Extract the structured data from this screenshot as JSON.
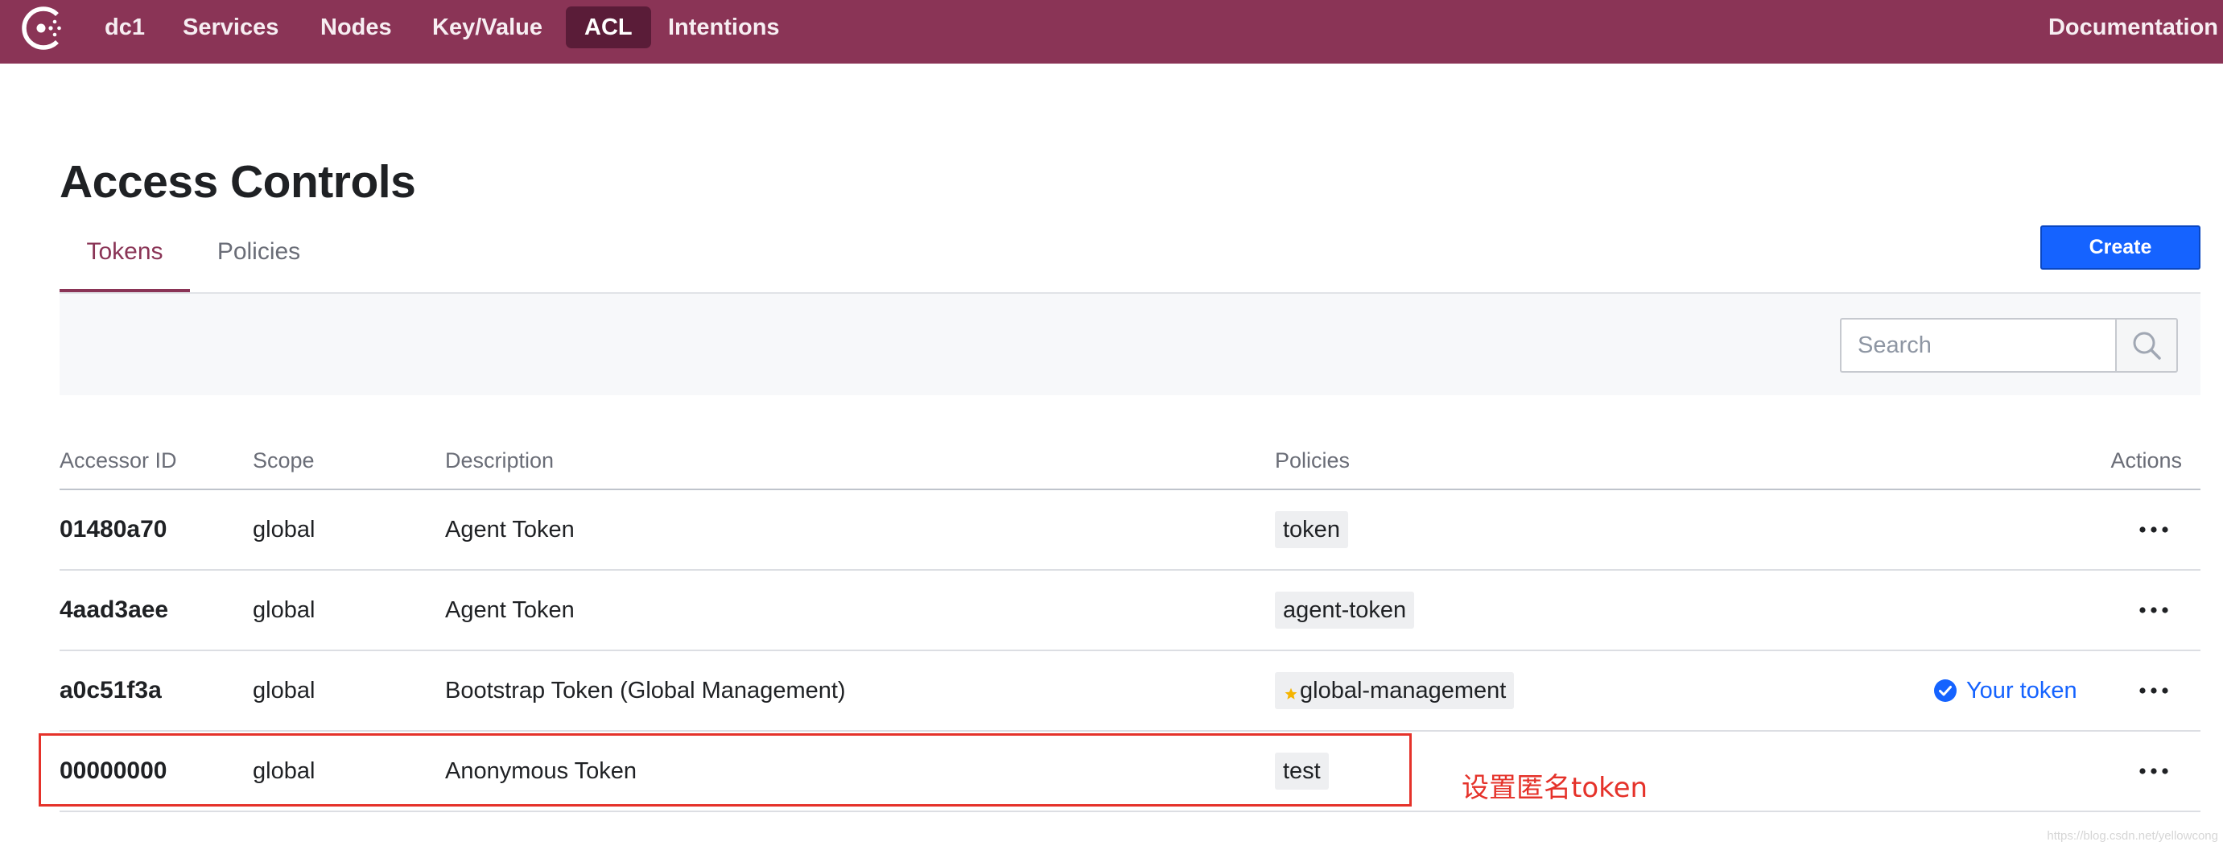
{
  "nav": {
    "logo_icon": "consul-logo",
    "datacenter": "dc1",
    "items": [
      {
        "label": "Services",
        "active": false
      },
      {
        "label": "Nodes",
        "active": false
      },
      {
        "label": "Key/Value",
        "active": false
      },
      {
        "label": "ACL",
        "active": true
      },
      {
        "label": "Intentions",
        "active": false
      }
    ],
    "documentation": "Documentation"
  },
  "page": {
    "title": "Access Controls",
    "tabs": [
      {
        "label": "Tokens",
        "active": true
      },
      {
        "label": "Policies",
        "active": false
      }
    ],
    "create_label": "Create"
  },
  "search": {
    "placeholder": "Search",
    "button_icon": "search-icon"
  },
  "table": {
    "columns": [
      "Accessor ID",
      "Scope",
      "Description",
      "Policies",
      "Actions"
    ],
    "actions_icon": "more-horizontal-icon",
    "rows": [
      {
        "accessor_id": "01480a70",
        "scope": "global",
        "description": "Agent Token",
        "policies": [
          {
            "name": "token",
            "builtin": false
          }
        ]
      },
      {
        "accessor_id": "4aad3aee",
        "scope": "global",
        "description": "Agent Token",
        "policies": [
          {
            "name": "agent-token",
            "builtin": false
          }
        ]
      },
      {
        "accessor_id": "a0c51f3a",
        "scope": "global",
        "description": "Bootstrap Token (Global Management)",
        "policies": [
          {
            "name": "global-management",
            "builtin": true,
            "icon": "star-icon"
          }
        ],
        "your_token_label": "Your token",
        "your_token_icon": "check-circle-icon"
      },
      {
        "accessor_id": "00000000",
        "scope": "global",
        "description": "Anonymous Token",
        "policies": [
          {
            "name": "test",
            "builtin": false
          }
        ],
        "highlighted": true
      }
    ]
  },
  "annotation": {
    "text": "设置匿名token"
  },
  "watermark": "https://blog.csdn.net/yellowcong",
  "colors": {
    "nav_background": "#8a3456",
    "nav_active_background": "#5a1c38",
    "accent": "#8a3456",
    "primary_button": "#1563ff",
    "link": "#1563ff",
    "star": "#f5b400",
    "annotation": "#e5322a"
  }
}
